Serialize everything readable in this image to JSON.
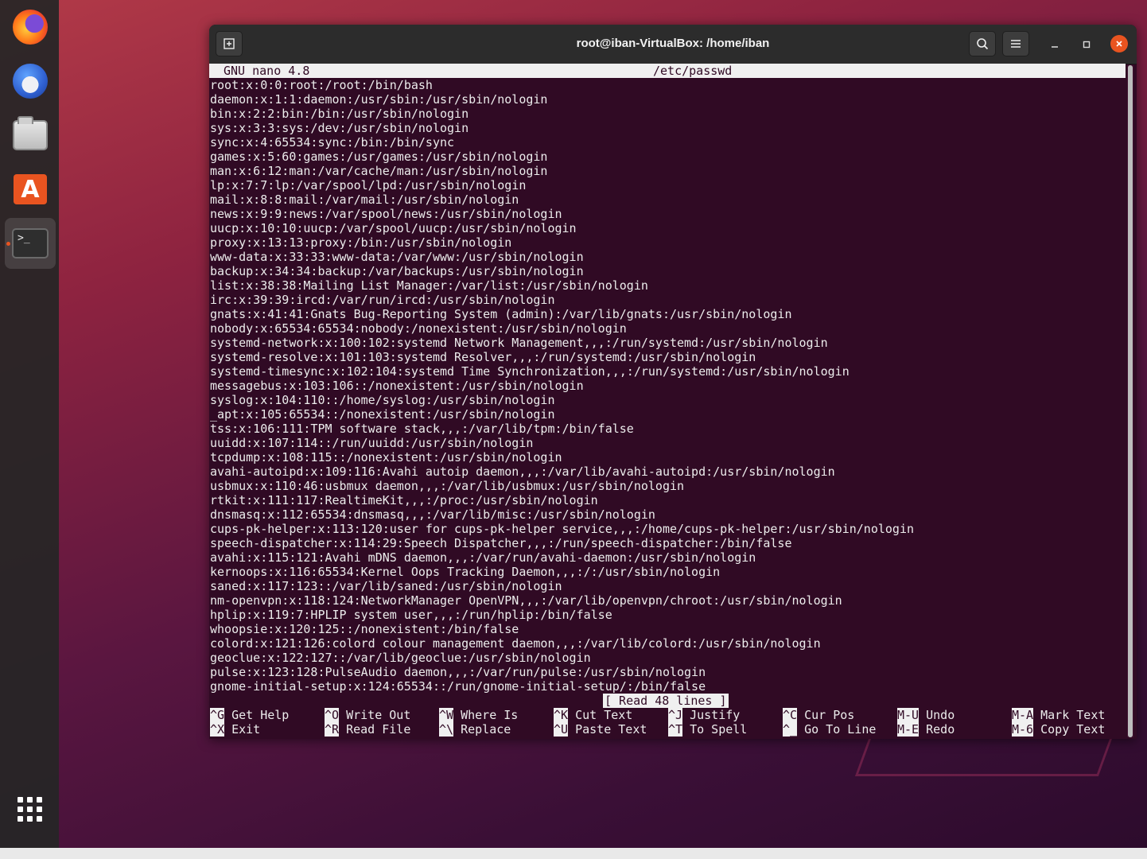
{
  "window": {
    "title": "root@iban-VirtualBox: /home/iban"
  },
  "dock": {
    "items": [
      {
        "name": "firefox",
        "icon": "firefox-icon"
      },
      {
        "name": "thunderbird",
        "icon": "thunderbird-icon"
      },
      {
        "name": "files",
        "icon": "files-icon"
      },
      {
        "name": "ubuntu-software",
        "icon": "software-store-icon",
        "glyph": "A"
      },
      {
        "name": "terminal",
        "icon": "terminal-icon",
        "glyph": ">_"
      }
    ]
  },
  "nano": {
    "version": "GNU nano 4.8",
    "filename": "/etc/passwd",
    "lines": [
      "root:x:0:0:root:/root:/bin/bash",
      "daemon:x:1:1:daemon:/usr/sbin:/usr/sbin/nologin",
      "bin:x:2:2:bin:/bin:/usr/sbin/nologin",
      "sys:x:3:3:sys:/dev:/usr/sbin/nologin",
      "sync:x:4:65534:sync:/bin:/bin/sync",
      "games:x:5:60:games:/usr/games:/usr/sbin/nologin",
      "man:x:6:12:man:/var/cache/man:/usr/sbin/nologin",
      "lp:x:7:7:lp:/var/spool/lpd:/usr/sbin/nologin",
      "mail:x:8:8:mail:/var/mail:/usr/sbin/nologin",
      "news:x:9:9:news:/var/spool/news:/usr/sbin/nologin",
      "uucp:x:10:10:uucp:/var/spool/uucp:/usr/sbin/nologin",
      "proxy:x:13:13:proxy:/bin:/usr/sbin/nologin",
      "www-data:x:33:33:www-data:/var/www:/usr/sbin/nologin",
      "backup:x:34:34:backup:/var/backups:/usr/sbin/nologin",
      "list:x:38:38:Mailing List Manager:/var/list:/usr/sbin/nologin",
      "irc:x:39:39:ircd:/var/run/ircd:/usr/sbin/nologin",
      "gnats:x:41:41:Gnats Bug-Reporting System (admin):/var/lib/gnats:/usr/sbin/nologin",
      "nobody:x:65534:65534:nobody:/nonexistent:/usr/sbin/nologin",
      "systemd-network:x:100:102:systemd Network Management,,,:/run/systemd:/usr/sbin/nologin",
      "systemd-resolve:x:101:103:systemd Resolver,,,:/run/systemd:/usr/sbin/nologin",
      "systemd-timesync:x:102:104:systemd Time Synchronization,,,:/run/systemd:/usr/sbin/nologin",
      "messagebus:x:103:106::/nonexistent:/usr/sbin/nologin",
      "syslog:x:104:110::/home/syslog:/usr/sbin/nologin",
      "_apt:x:105:65534::/nonexistent:/usr/sbin/nologin",
      "tss:x:106:111:TPM software stack,,,:/var/lib/tpm:/bin/false",
      "uuidd:x:107:114::/run/uuidd:/usr/sbin/nologin",
      "tcpdump:x:108:115::/nonexistent:/usr/sbin/nologin",
      "avahi-autoipd:x:109:116:Avahi autoip daemon,,,:/var/lib/avahi-autoipd:/usr/sbin/nologin",
      "usbmux:x:110:46:usbmux daemon,,,:/var/lib/usbmux:/usr/sbin/nologin",
      "rtkit:x:111:117:RealtimeKit,,,:/proc:/usr/sbin/nologin",
      "dnsmasq:x:112:65534:dnsmasq,,,:/var/lib/misc:/usr/sbin/nologin",
      "cups-pk-helper:x:113:120:user for cups-pk-helper service,,,:/home/cups-pk-helper:/usr/sbin/nologin",
      "speech-dispatcher:x:114:29:Speech Dispatcher,,,:/run/speech-dispatcher:/bin/false",
      "avahi:x:115:121:Avahi mDNS daemon,,,:/var/run/avahi-daemon:/usr/sbin/nologin",
      "kernoops:x:116:65534:Kernel Oops Tracking Daemon,,,:/:/usr/sbin/nologin",
      "saned:x:117:123::/var/lib/saned:/usr/sbin/nologin",
      "nm-openvpn:x:118:124:NetworkManager OpenVPN,,,:/var/lib/openvpn/chroot:/usr/sbin/nologin",
      "hplip:x:119:7:HPLIP system user,,,:/run/hplip:/bin/false",
      "whoopsie:x:120:125::/nonexistent:/bin/false",
      "colord:x:121:126:colord colour management daemon,,,:/var/lib/colord:/usr/sbin/nologin",
      "geoclue:x:122:127::/var/lib/geoclue:/usr/sbin/nologin",
      "pulse:x:123:128:PulseAudio daemon,,,:/var/run/pulse:/usr/sbin/nologin",
      "gnome-initial-setup:x:124:65534::/run/gnome-initial-setup/:/bin/false"
    ],
    "status": "[ Read 48 lines ]",
    "shortcuts_row1": [
      {
        "key": "^G",
        "label": "Get Help"
      },
      {
        "key": "^O",
        "label": "Write Out"
      },
      {
        "key": "^W",
        "label": "Where Is"
      },
      {
        "key": "^K",
        "label": "Cut Text"
      },
      {
        "key": "^J",
        "label": "Justify"
      },
      {
        "key": "^C",
        "label": "Cur Pos"
      },
      {
        "key": "M-U",
        "label": "Undo"
      },
      {
        "key": "M-A",
        "label": "Mark Text"
      }
    ],
    "shortcuts_row2": [
      {
        "key": "^X",
        "label": "Exit"
      },
      {
        "key": "^R",
        "label": "Read File"
      },
      {
        "key": "^\\",
        "label": "Replace"
      },
      {
        "key": "^U",
        "label": "Paste Text"
      },
      {
        "key": "^T",
        "label": "To Spell"
      },
      {
        "key": "^_",
        "label": "Go To Line"
      },
      {
        "key": "M-E",
        "label": "Redo"
      },
      {
        "key": "M-6",
        "label": "Copy Text"
      }
    ]
  },
  "colors": {
    "terminal_bg": "#300a24",
    "accent": "#e95420",
    "titlebar": "#2c2c2c"
  }
}
